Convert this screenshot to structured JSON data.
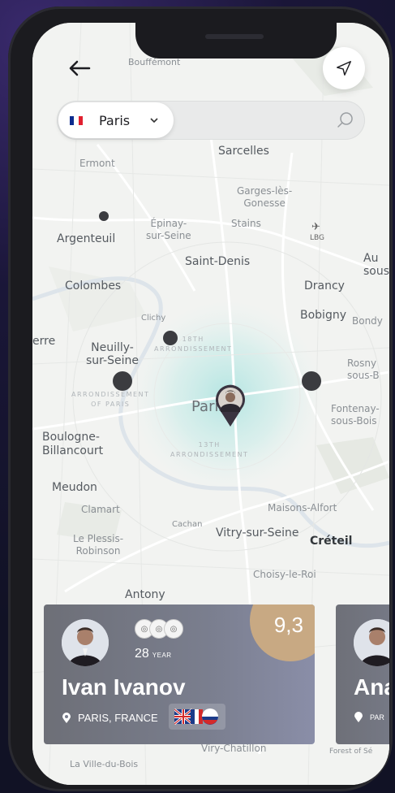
{
  "header": {
    "back_icon": "arrow-left-icon",
    "locate_icon": "navigation-arrow-icon"
  },
  "search": {
    "city": "Paris",
    "city_flag": [
      "#0d2c8f",
      "#ffffff",
      "#e1202f"
    ],
    "placeholder": "",
    "search_icon": "search-icon"
  },
  "map": {
    "labels": {
      "bouffemont": "Bouffémont",
      "sarcelles": "Sarcelles",
      "ermont": "Ermont",
      "garges": "Garges-lès-\nGonesse",
      "epinay": "Épinay-\nsur-Seine",
      "stains": "Stains",
      "lbg": "LBG",
      "argenteuil": "Argenteuil",
      "saint_denis": "Saint-Denis",
      "aulnay": "Au\nsous",
      "colombes": "Colombes",
      "drancy": "Drancy",
      "clichy": "Clichy",
      "bobigny": "Bobigny",
      "bondy": "Bondy",
      "erre": "erre",
      "neuilly": "Neuilly-\nsur-Seine",
      "arr18": "18TH\nARRONDISSEMENT",
      "rosny": "Rosny\nsous-B",
      "arr16": "ARRONDISSEMENT\nOF PARIS",
      "paris": "Paris",
      "fontenay": "Fontenay-\nsous-Bois",
      "boulogne": "Boulogne-\nBillancourt",
      "arr13": "13TH\nARRONDISSEMENT",
      "meudon": "Meudon",
      "clamart": "Clamart",
      "maisons": "Maisons-Alfort",
      "cachan": "Cachan",
      "vitry": "Vitry-sur-Seine",
      "creteil": "Créteil",
      "plessis": "Le Plessis-\nRobinson",
      "choisy": "Choisy-le-Roi",
      "antony": "Antony",
      "viry": "Viry-Chatillon",
      "ville_du_bois": "La Ville-du-Bois",
      "forest": "Forest of Sé"
    },
    "marker_icon": "map-pin-icon",
    "highlight_color": "#9fe0dd"
  },
  "cards": [
    {
      "score": "9,3",
      "badges": [
        "◎",
        "◎",
        "◎"
      ],
      "age_number": "28",
      "age_unit": "YEAR",
      "name": "Ivan Ivanov",
      "location": "PARIS, FRANCE",
      "languages": [
        "uk-flag-icon",
        "fr-flag-icon",
        "ru-flag-icon"
      ]
    },
    {
      "name": "Ana",
      "location": "PAR"
    }
  ]
}
